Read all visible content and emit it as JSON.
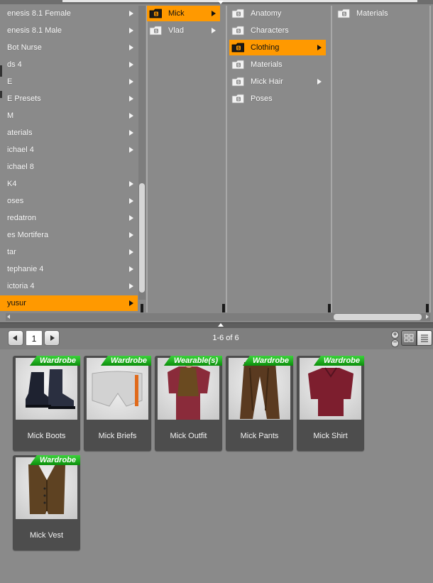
{
  "browser": {
    "column1": [
      {
        "label": "enesis 8.1 Female",
        "arrow": true
      },
      {
        "label": "enesis 8.1 Male",
        "arrow": true
      },
      {
        "label": "Bot Nurse",
        "arrow": true
      },
      {
        "label": "ds 4",
        "arrow": true
      },
      {
        "label": "E",
        "arrow": true
      },
      {
        "label": "E Presets",
        "arrow": true
      },
      {
        "label": "M",
        "arrow": true
      },
      {
        "label": "aterials",
        "arrow": true
      },
      {
        "label": "ichael 4",
        "arrow": true
      },
      {
        "label": "ichael 8",
        "arrow": false
      },
      {
        "label": "K4",
        "arrow": true
      },
      {
        "label": "oses",
        "arrow": true
      },
      {
        "label": "redatron",
        "arrow": true
      },
      {
        "label": "es Mortifera",
        "arrow": true
      },
      {
        "label": "tar",
        "arrow": true
      },
      {
        "label": "tephanie 4",
        "arrow": true
      },
      {
        "label": "ictoria 4",
        "arrow": true
      },
      {
        "label": "yusur",
        "arrow": true,
        "selected": true
      }
    ],
    "column2": [
      {
        "label": "Mick",
        "arrow": true,
        "selected": true
      },
      {
        "label": "Vlad",
        "arrow": true
      }
    ],
    "column3": [
      {
        "label": "Anatomy",
        "arrow": false
      },
      {
        "label": "Characters",
        "arrow": false
      },
      {
        "label": "Clothing",
        "arrow": true,
        "selected": true
      },
      {
        "label": "Materials",
        "arrow": false
      },
      {
        "label": "Mick Hair",
        "arrow": true
      },
      {
        "label": "Poses",
        "arrow": false
      }
    ],
    "column4": [
      {
        "label": "Materials",
        "arrow": false
      }
    ]
  },
  "pager": {
    "page": "1",
    "summary": "1-6 of 6"
  },
  "items": [
    {
      "label": "Mick Boots",
      "badge": "Wardrobe"
    },
    {
      "label": "Mick Briefs",
      "badge": "Wardrobe"
    },
    {
      "label": "Mick Outfit",
      "badge": "Wearable(s)"
    },
    {
      "label": "Mick Pants",
      "badge": "Wardrobe"
    },
    {
      "label": "Mick Shirt",
      "badge": "Wardrobe"
    },
    {
      "label": "Mick Vest",
      "badge": "Wardrobe"
    }
  ],
  "colors": {
    "selection": "#ff9900",
    "badge": "#1fb81f",
    "panel": "#8a8a8a",
    "tile": "#4d4d4d"
  }
}
